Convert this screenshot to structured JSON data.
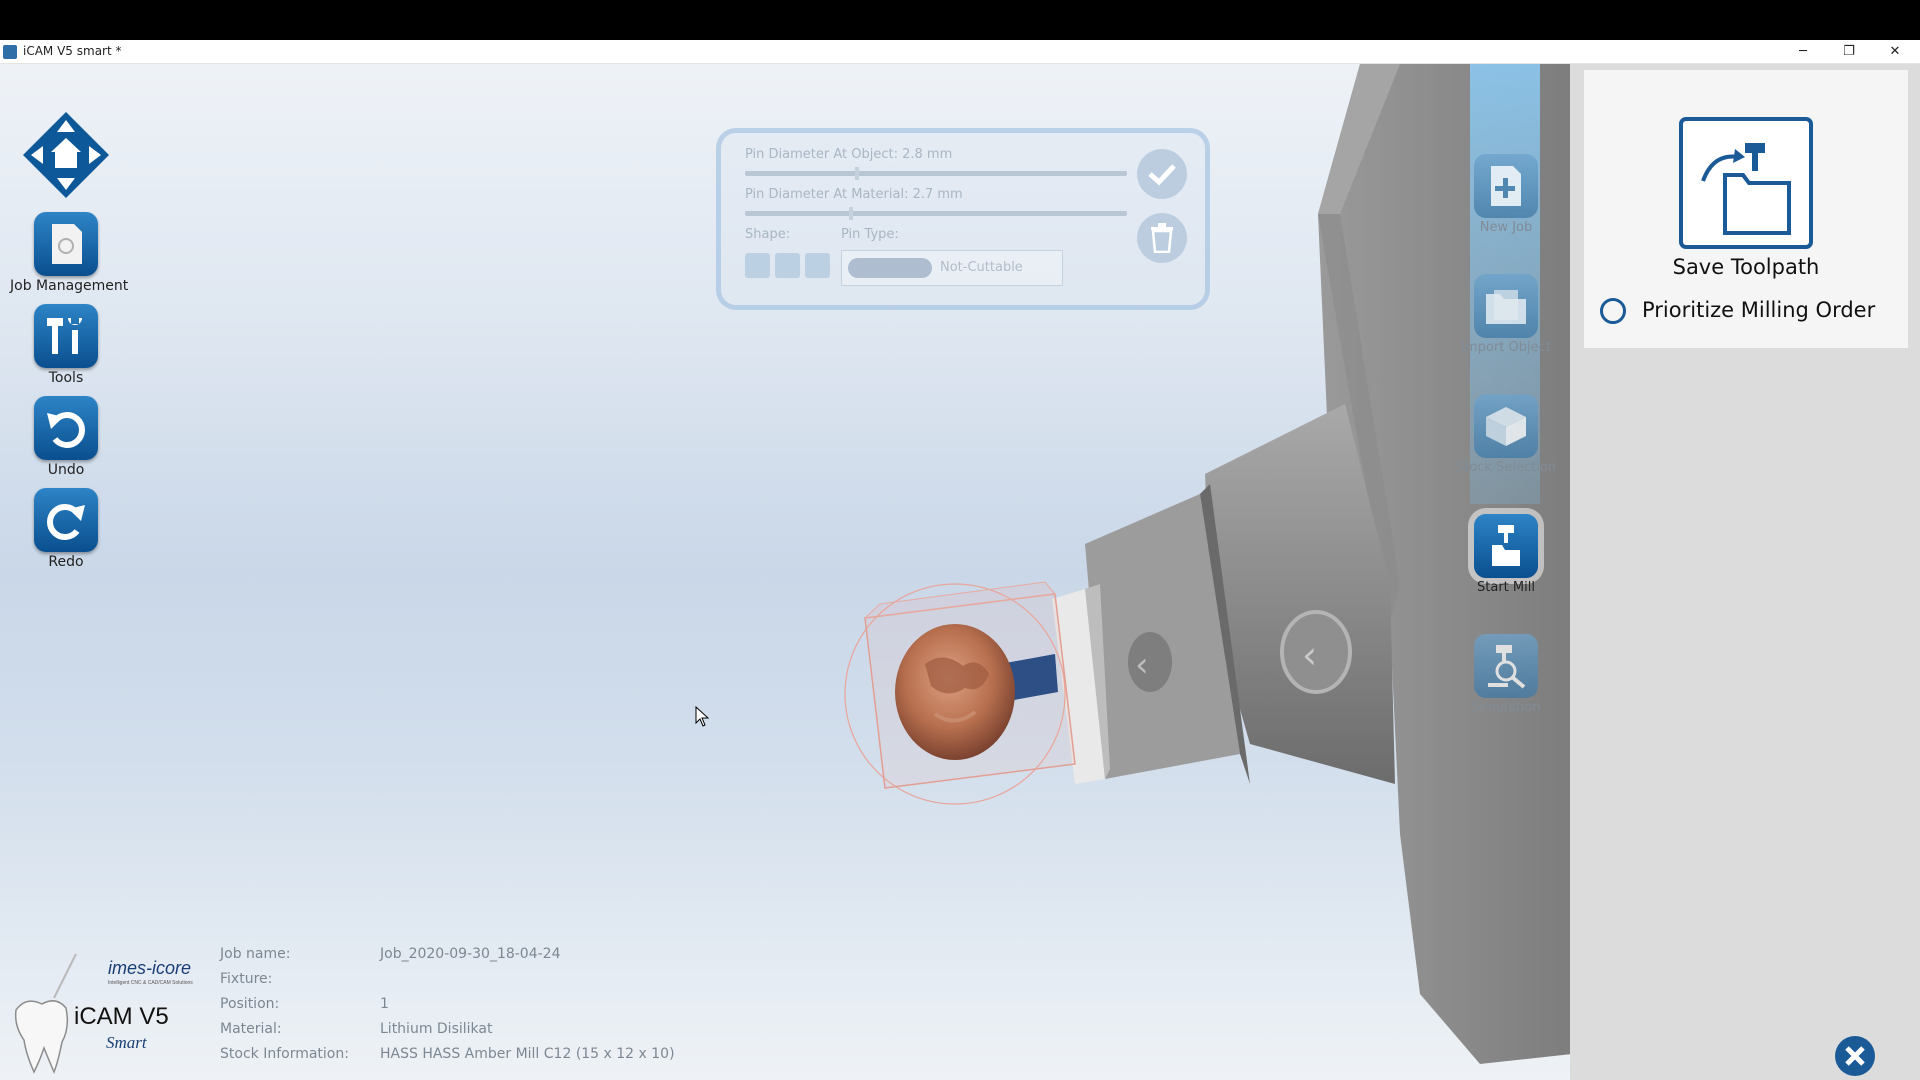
{
  "window": {
    "title": "iCAM V5 smart *",
    "controls": [
      "minimize",
      "restore",
      "close"
    ]
  },
  "left_toolbar": [
    {
      "key": "navigation",
      "label": "",
      "icon": "navigation-cross-icon"
    },
    {
      "key": "job_management",
      "label": "Job Management",
      "icon": "document-icon"
    },
    {
      "key": "tools",
      "label": "Tools",
      "icon": "tools-icon"
    },
    {
      "key": "undo",
      "label": "Undo",
      "icon": "undo-icon"
    },
    {
      "key": "redo",
      "label": "Redo",
      "icon": "redo-icon"
    }
  ],
  "pin_panel": {
    "diameter_object": "Pin Diameter At Object: 2.8 mm",
    "diameter_material": "Pin Diameter At Material: 2.7 mm",
    "shape_label": "Shape:",
    "pin_type_label": "Pin Type:",
    "pin_type_value": "Not-Cuttable"
  },
  "right_toolbar": [
    {
      "key": "new_job",
      "label": "New Job",
      "state": "faded"
    },
    {
      "key": "import_object",
      "label": "Import Object",
      "state": "faded"
    },
    {
      "key": "stock_selection",
      "label": "Stock Selection",
      "state": "faded"
    },
    {
      "key": "start_mill",
      "label": "Start Mill",
      "state": "active"
    },
    {
      "key": "simulation",
      "label": "Simulation",
      "state": "faded"
    }
  ],
  "right_panel": {
    "save_label": "Save Toolpath",
    "prioritize_label": "Prioritize Milling Order",
    "prioritize_checked": false
  },
  "logo": {
    "brand": "imes-icore",
    "brand_sub": "Intelligent CNC & CAD/CAM Solutions",
    "product": "iCAM V5",
    "edition": "Smart"
  },
  "job_info": {
    "labels": {
      "job_name": "Job name:",
      "fixture": "Fixture:",
      "position": "Position:",
      "material": "Material:",
      "stock": "Stock Information:"
    },
    "values": {
      "job_name": "Job_2020-09-30_18-04-24",
      "fixture": "",
      "position": "1",
      "material": "Lithium Disilikat",
      "stock": "HASS HASS Amber Mill C12 (15 x 12 x 10)"
    }
  },
  "colors": {
    "accent": "#1a5a97",
    "crown": "#b86e4f",
    "machine": "#8e8e8e",
    "panel": "#dcdcdc"
  }
}
